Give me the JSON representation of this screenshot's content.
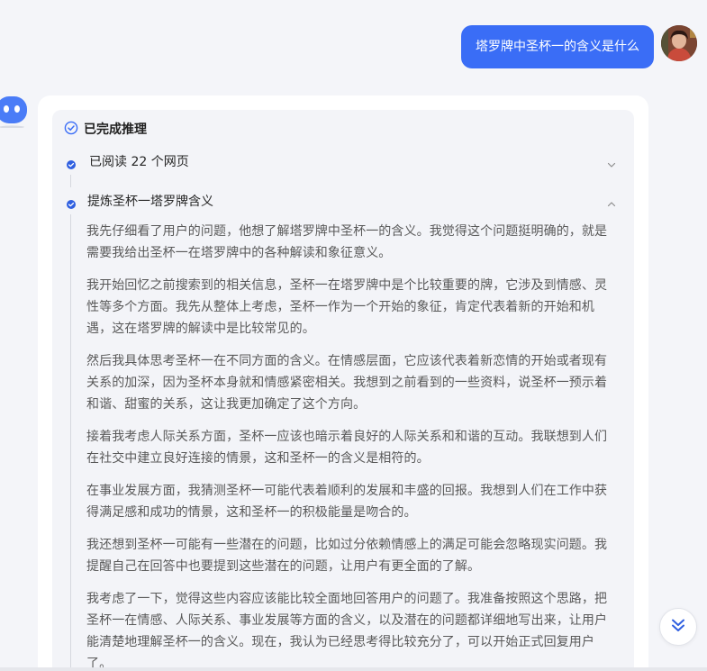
{
  "user_message": "塔罗牌中圣杯一的含义是什么",
  "reasoning": {
    "status_title": "已完成推理",
    "steps": [
      {
        "label": "已阅读 22 个网页",
        "expanded": false
      },
      {
        "label": "提炼圣杯一塔罗牌含义",
        "expanded": true
      }
    ],
    "paragraphs": [
      "我先仔细看了用户的问题，他想了解塔罗牌中圣杯一的含义。我觉得这个问题挺明确的，就是需要我给出圣杯一在塔罗牌中的各种解读和象征意义。",
      "我开始回忆之前搜索到的相关信息，圣杯一在塔罗牌中是个比较重要的牌，它涉及到情感、灵性等多个方面。我先从整体上考虑，圣杯一作为一个开始的象征，肯定代表着新的开始和机遇，这在塔罗牌的解读中是比较常见的。",
      "然后我具体思考圣杯一在不同方面的含义。在情感层面，它应该代表着新恋情的开始或者现有关系的加深，因为圣杯本身就和情感紧密相关。我想到之前看到的一些资料，说圣杯一预示着和谐、甜蜜的关系，这让我更加确定了这个方向。",
      "接着我考虑人际关系方面，圣杯一应该也暗示着良好的人际关系和和谐的互动。我联想到人们在社交中建立良好连接的情景，这和圣杯一的含义是相符的。",
      "在事业发展方面，我猜测圣杯一可能代表着顺利的发展和丰盛的回报。我想到人们在工作中获得满足感和成功的情景，这和圣杯一的积极能量是吻合的。",
      "我还想到圣杯一可能有一些潜在的问题，比如过分依赖情感上的满足可能会忽略现实问题。我提醒自己在回答中也要提到这些潜在的问题，让用户有更全面的了解。",
      "我考虑了一下，觉得这些内容应该能比较全面地回答用户的问题了。我准备按照这个思路，把圣杯一在情感、人际关系、事业发展等方面的含义，以及潜在的问题都详细地写出来，让用户能清楚地理解圣杯一的含义。现在，我认为已经思考得比较充分了，可以开始正式回复用户了。"
    ]
  },
  "colors": {
    "accent": "#3a6df6",
    "page_bg": "#f4f5f9",
    "reason_bg": "#f3f4f8",
    "body_text": "#595959"
  },
  "icons": {
    "status": "check-circle-icon",
    "step": "check-dot-icon",
    "collapsed": "chevron-down-icon",
    "expanded": "chevron-up-icon",
    "scroll": "double-chevron-down-icon",
    "bot": "bot-avatar-icon"
  }
}
